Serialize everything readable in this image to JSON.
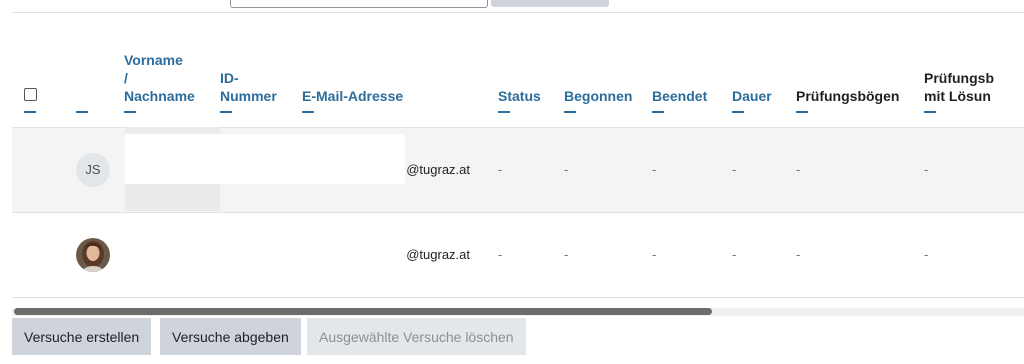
{
  "table": {
    "headers": {
      "name_part1": "Vorname",
      "name_sep": "/",
      "name_part2": "Nachname",
      "id_part1": "ID-",
      "id_part2": "Nummer",
      "email": "E-Mail-Adresse",
      "status": "Status",
      "started": "Begonnen",
      "finished": "Beendet",
      "duration": "Dauer",
      "sheets": "Prüfungsbögen",
      "solutions_part1": "Prüfungsb",
      "solutions_part2": "mit Lösun"
    },
    "rows": [
      {
        "initials": "JS",
        "email": "@tugraz.at",
        "status": "-",
        "started": "-",
        "finished": "-",
        "duration": "-",
        "sheets": "-",
        "solutions": "-"
      },
      {
        "initials": "",
        "email": "@tugraz.at",
        "status": "-",
        "started": "-",
        "finished": "-",
        "duration": "-",
        "sheets": "-",
        "solutions": "-"
      }
    ]
  },
  "scroll": {
    "horizontal_thumb_fraction": 0.69
  },
  "buttons": {
    "create": "Versuche erstellen",
    "submit": "Versuche abgeben",
    "delete": "Ausgewählte Versuche löschen"
  },
  "colors": {
    "link": "#2c6d9c",
    "button": "#ced4da",
    "button_disabled": "#e4e7ea"
  }
}
